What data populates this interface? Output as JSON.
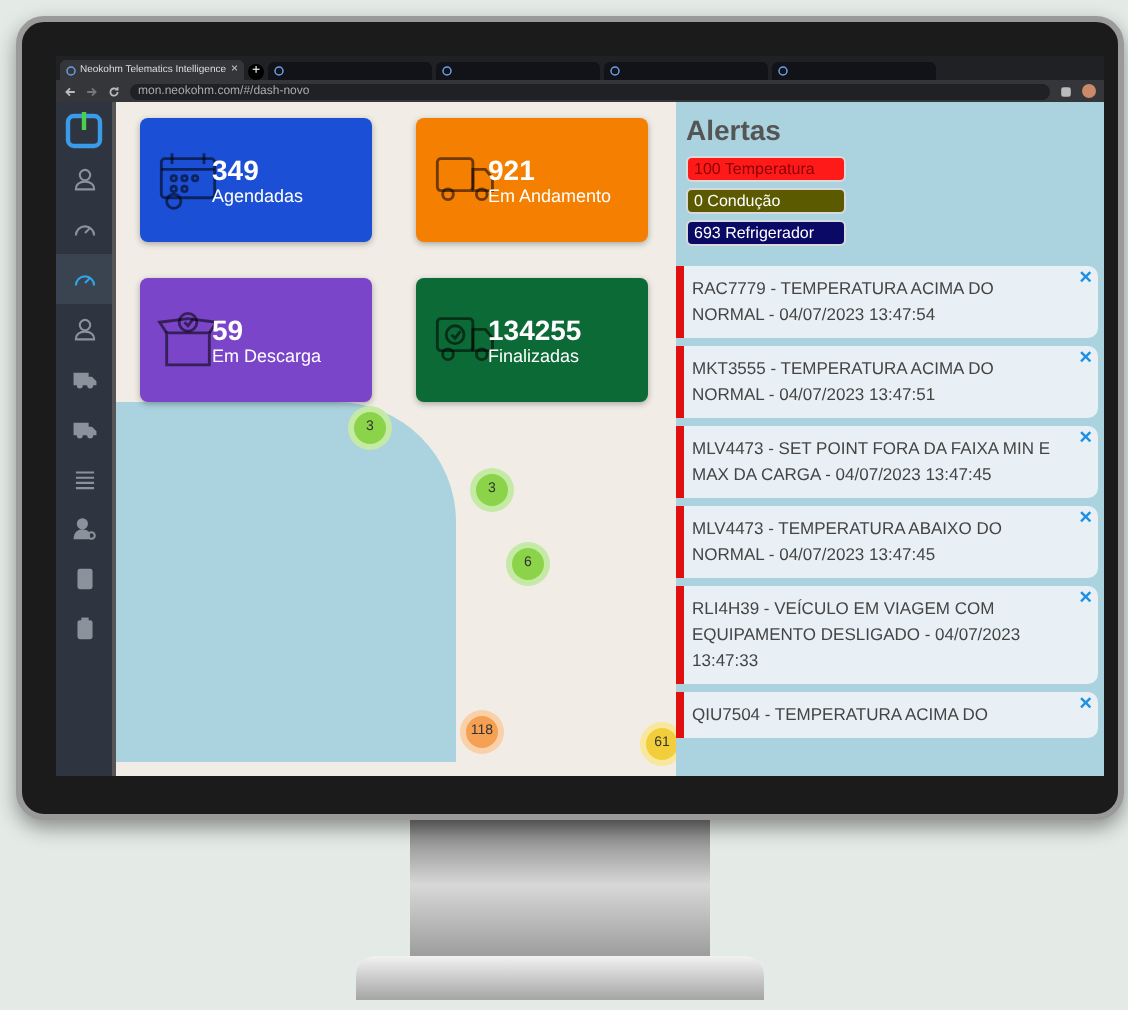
{
  "browser": {
    "tabs": [
      {
        "title": "Neokohm Telematics Intelligence",
        "close": "×",
        "selected": true
      },
      {
        "selected": false
      },
      {
        "selected": false
      },
      {
        "selected": false
      },
      {
        "selected": false
      }
    ],
    "new_tab": "+",
    "url": "mon.neokohm.com/#/dash-novo"
  },
  "sidebar": {
    "items": [
      {
        "selected": false
      },
      {
        "selected": false
      },
      {
        "selected": true
      },
      {
        "selected": false
      },
      {
        "selected": false
      },
      {
        "selected": false
      },
      {
        "selected": false
      },
      {
        "selected": false
      },
      {
        "selected": false
      },
      {
        "selected": false
      }
    ]
  },
  "cards": [
    {
      "value": "349",
      "label": "Agendadas",
      "color": "#1b4fd6"
    },
    {
      "value": "921",
      "label": "Em Andamento",
      "color": "#f57f00"
    },
    {
      "value": "59",
      "label": "Em Descarga",
      "color": "#7a45c8"
    },
    {
      "value": "134255",
      "label": "Finalizadas",
      "color": "#0c6a37"
    }
  ],
  "map": {
    "clusters": [
      {
        "count": "3",
        "color": "#8bd44a"
      },
      {
        "count": "3",
        "color": "#8bd44a"
      },
      {
        "count": "6",
        "color": "#8bd44a"
      },
      {
        "count": "118",
        "color": "#f5a052"
      },
      {
        "count": "61",
        "color": "#f2cf3a"
      }
    ]
  },
  "alerts": {
    "title": "Alertas",
    "badges": [
      {
        "label": "100 Temperatura",
        "color": "#ff1a1a"
      },
      {
        "label": "0 Condução",
        "color": "#5c5a00"
      },
      {
        "label": "693 Refrigerador",
        "color": "#0a0a66"
      }
    ],
    "items": [
      {
        "text": "RAC7779 - TEMPERATURA ACIMA DO NORMAL - 04/07/2023 13:47:54",
        "close": "×"
      },
      {
        "text": "MKT3555 - TEMPERATURA ACIMA DO NORMAL - 04/07/2023 13:47:51",
        "close": "×"
      },
      {
        "text": "MLV4473 - SET POINT FORA DA FAIXA MIN E MAX DA CARGA - 04/07/2023 13:47:45",
        "close": "×"
      },
      {
        "text": "MLV4473 - TEMPERATURA ABAIXO DO NORMAL - 04/07/2023 13:47:45",
        "close": "×"
      },
      {
        "text": "RLI4H39 - VEÍCULO EM VIAGEM COM EQUIPAMENTO DESLIGADO - 04/07/2023 13:47:33",
        "close": "×"
      },
      {
        "text": "QIU7504 - TEMPERATURA ACIMA DO",
        "close": "×"
      }
    ]
  }
}
